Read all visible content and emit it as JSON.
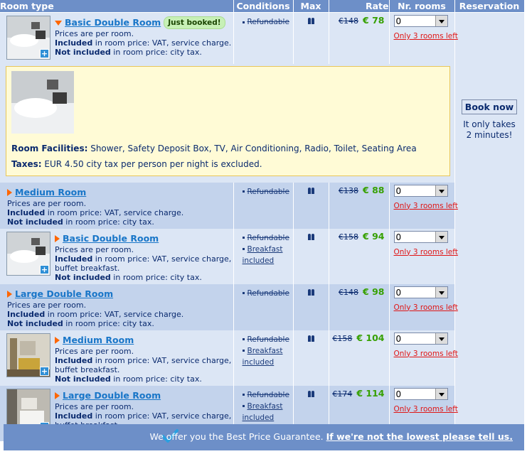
{
  "headers": {
    "room_type": "Room type",
    "conditions": "Conditions",
    "max": "Max",
    "rate": "Rate",
    "nr_rooms": "Nr. rooms",
    "reservation": "Reservation"
  },
  "common": {
    "prices_per_room": "Prices are per room.",
    "included_label": "Included",
    "not_included_label": "Not included",
    "in_room_price": " in room price: ",
    "city_tax": "city tax."
  },
  "rooms": [
    {
      "name": "Basic Double Room",
      "badge": "Just booked!",
      "included": "VAT, service charge.",
      "cond1": "Refundable",
      "cond2": "",
      "old_rate": "€148",
      "new_rate": "€ 78",
      "nr_value": "0",
      "rooms_left": "Only 3 rooms left",
      "thumb": "bed"
    },
    {
      "name": "Medium Room",
      "badge": "",
      "included": "VAT, service charge.",
      "cond1": "Refundable",
      "cond2": "",
      "old_rate": "€138",
      "new_rate": "€ 88",
      "nr_value": "0",
      "rooms_left": "Only 3 rooms left",
      "thumb": ""
    },
    {
      "name": "Basic Double Room",
      "badge": "",
      "included": "VAT, service charge,",
      "included2": "buffet breakfast.",
      "cond1": "Refundable",
      "cond2": "Breakfast",
      "cond3": "included",
      "old_rate": "€158",
      "new_rate": "€ 94",
      "nr_value": "0",
      "rooms_left": "Only 3 rooms left",
      "thumb": "bed"
    },
    {
      "name": "Large Double Room",
      "badge": "",
      "included": "VAT, service charge.",
      "cond1": "Refundable",
      "cond2": "",
      "old_rate": "€148",
      "new_rate": "€ 98",
      "nr_value": "0",
      "rooms_left": "Only 3 rooms left",
      "thumb": ""
    },
    {
      "name": "Medium Room",
      "badge": "",
      "included": "VAT, service charge,",
      "included2": "buffet breakfast.",
      "cond1": "Refundable",
      "cond2": "Breakfast",
      "cond3": "included",
      "old_rate": "€158",
      "new_rate": "€ 104",
      "nr_value": "0",
      "rooms_left": "Only 3 rooms left",
      "thumb": "room"
    },
    {
      "name": "Large Double Room",
      "badge": "",
      "included": "VAT, service charge,",
      "included2": "buffet breakfast.",
      "cond1": "Refundable",
      "cond2": "Breakfast",
      "cond3": "included",
      "old_rate": "€174",
      "new_rate": "€ 114",
      "nr_value": "0",
      "rooms_left": "Only 3 rooms left",
      "thumb": "room2"
    }
  ],
  "facilities": {
    "label": "Room Facilities:",
    "text": " Shower, Safety Deposit Box, TV, Air Conditioning, Radio, Toilet, Seating Area",
    "tax_label": "Taxes:",
    "tax_text": " EUR 4.50 city tax per person per night is excluded."
  },
  "reservation": {
    "book_label": "Book now",
    "takes_line1": "It only takes",
    "takes_line2": "2 minutes!"
  },
  "footer": {
    "guarantee": "We offer you the Best Price Guarantee.",
    "link": "If we're not the lowest please tell us."
  },
  "colors": {
    "header": "#6d8fc8",
    "row_light": "#dce6f5",
    "row_dark": "#c3d3ec",
    "price_green": "#36a000",
    "warning_red": "#e01515",
    "link_blue": "#1976c8"
  }
}
